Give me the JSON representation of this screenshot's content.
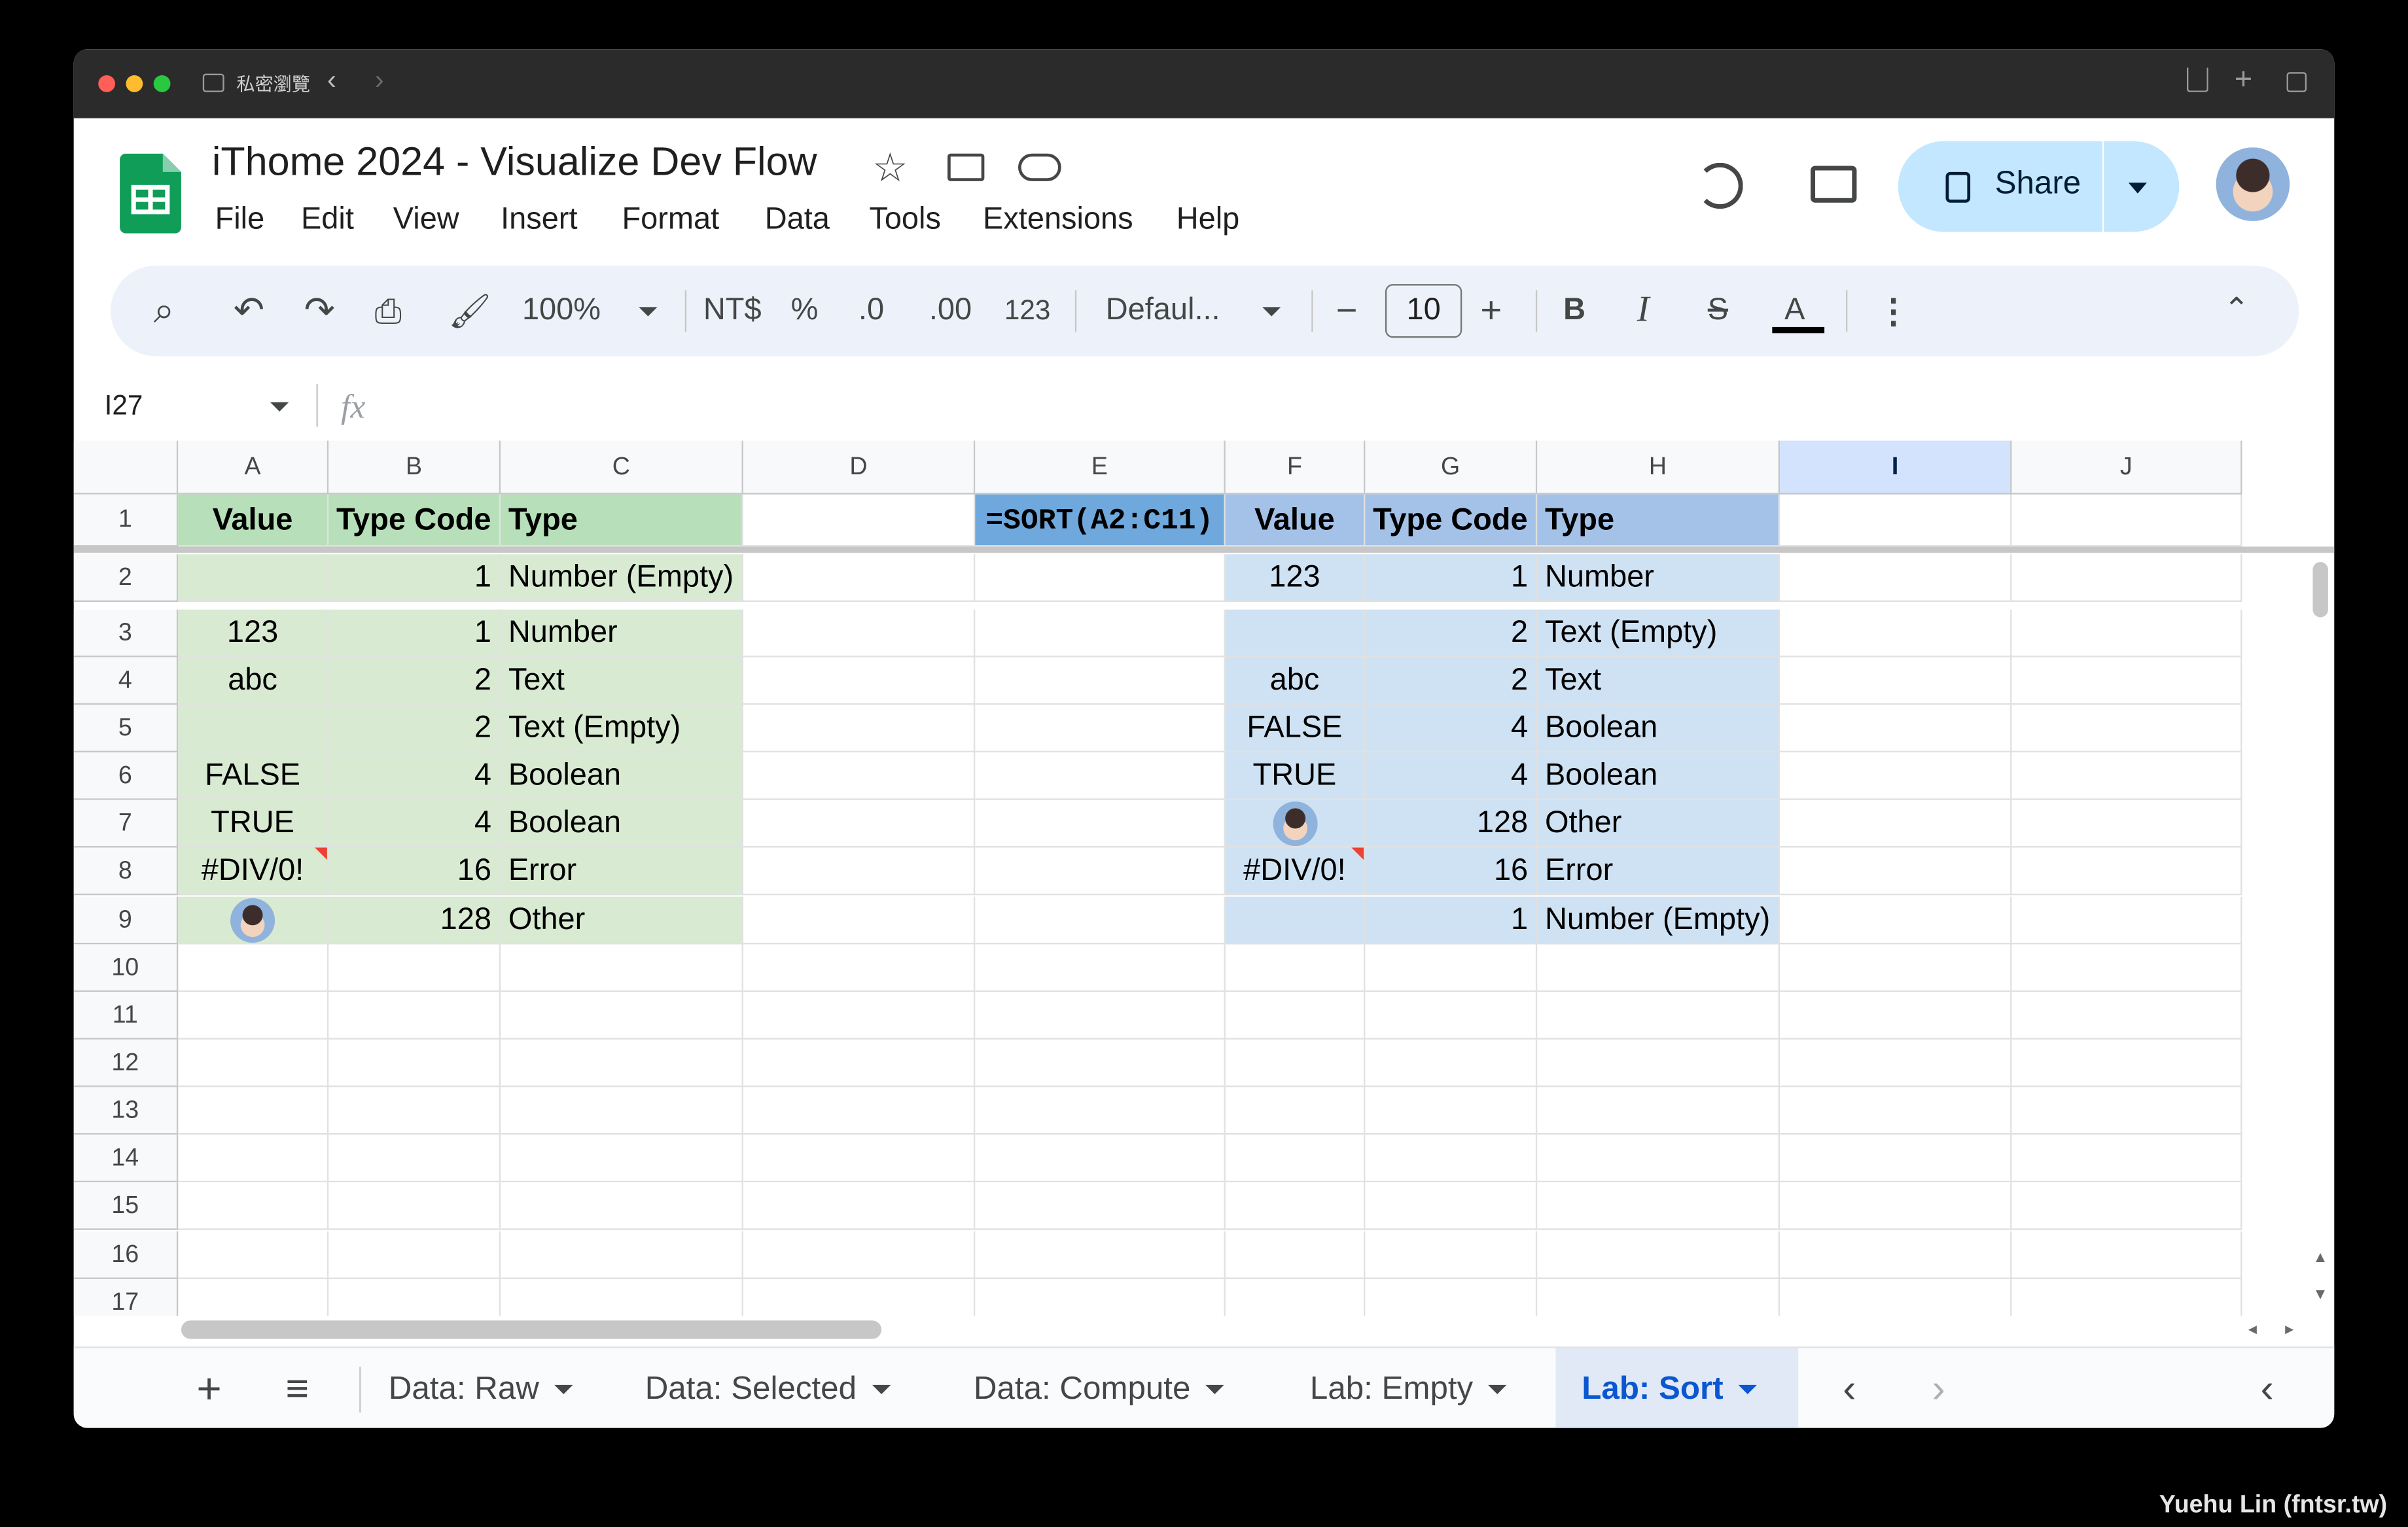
{
  "browser": {
    "tab_label": "私密瀏覽"
  },
  "doc": {
    "title": "iThome 2024 - Visualize Dev Flow"
  },
  "menu": [
    "File",
    "Edit",
    "View",
    "Insert",
    "Format",
    "Data",
    "Tools",
    "Extensions",
    "Help"
  ],
  "share": {
    "label": "Share"
  },
  "toolbar": {
    "zoom": "100%",
    "currency": "NT$",
    "percent": "%",
    "dec_less": ".0",
    "dec_more": ".00",
    "number_format": "123",
    "font": "Defaul...",
    "font_size": "10",
    "minus": "−",
    "plus": "+",
    "bold": "B",
    "italic": "I",
    "strike": "S",
    "text_color": "A"
  },
  "formula_bar": {
    "cell_ref": "I27",
    "fx": "fx",
    "value": ""
  },
  "columns": [
    "A",
    "B",
    "C",
    "D",
    "E",
    "F",
    "G",
    "H",
    "I",
    "J"
  ],
  "rows": [
    "1",
    "2",
    "3",
    "4",
    "5",
    "6",
    "7",
    "8",
    "9",
    "10",
    "11",
    "12",
    "13",
    "14",
    "15",
    "16",
    "17"
  ],
  "table_left": {
    "header": [
      "Value",
      "Type Code",
      "Type"
    ],
    "rows": [
      [
        "",
        "1",
        "Number (Empty)"
      ],
      [
        "123",
        "1",
        "Number"
      ],
      [
        "abc",
        "2",
        "Text"
      ],
      [
        "",
        "2",
        "Text (Empty)"
      ],
      [
        "FALSE",
        "4",
        "Boolean"
      ],
      [
        "TRUE",
        "4",
        "Boolean"
      ],
      [
        "#DIV/0!",
        "16",
        "Error"
      ],
      [
        "",
        "128",
        "Other"
      ]
    ]
  },
  "formula_cell": "=SORT(A2:C11)",
  "table_right": {
    "header": [
      "Value",
      "Type Code",
      "Type"
    ],
    "rows": [
      [
        "123",
        "1",
        "Number"
      ],
      [
        "",
        "2",
        "Text (Empty)"
      ],
      [
        "abc",
        "2",
        "Text"
      ],
      [
        "FALSE",
        "4",
        "Boolean"
      ],
      [
        "TRUE",
        "4",
        "Boolean"
      ],
      [
        "",
        "128",
        "Other"
      ],
      [
        "#DIV/0!",
        "16",
        "Error"
      ],
      [
        "",
        "1",
        "Number (Empty)"
      ]
    ]
  },
  "sheet_tabs": [
    "Data: Raw",
    "Data: Selected",
    "Data: Compute",
    "Lab: Empty",
    "Lab: Sort"
  ],
  "active_tab": "Lab: Sort",
  "watermark": "Yuehu Lin (fntsr.tw)",
  "colors": {
    "green_header": "#b7dfb9",
    "green_body": "#d9ead3",
    "blue_header": "#a4c2e8",
    "blue_body": "#cfe2f3",
    "formula": "#6fa8dc",
    "share_bg": "#c2e7ff",
    "active_tab": "#0b57d0"
  }
}
